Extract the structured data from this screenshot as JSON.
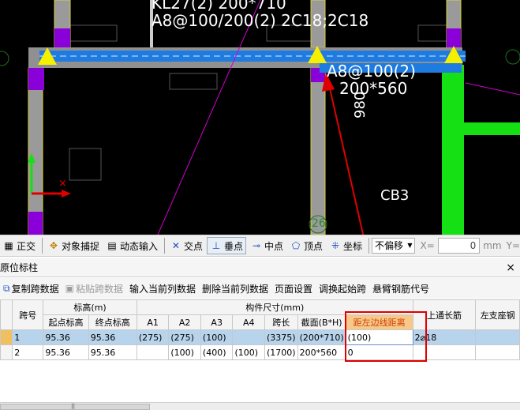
{
  "cad": {
    "beam_label_1": "KL27(2) 200*710",
    "beam_label_2": "A8@100/200(2) 2C18;2C18",
    "beam_label_3": "A8@100(2)",
    "beam_label_4": "200*560",
    "beam_label_5": "980",
    "beam_label_6": "CB3",
    "beam_label_7": "26"
  },
  "snapbar": {
    "items": [
      "正交",
      "对象捕捉",
      "动态输入",
      "交点",
      "垂点",
      "中点",
      "顶点",
      "坐标"
    ],
    "offset_select": "不偏移",
    "x_label": "X=",
    "x_value": "0",
    "unit": "mm",
    "y_label": "Y="
  },
  "panel": {
    "title": "原位标柱",
    "close": "×",
    "toolbar": [
      "复制跨数据",
      "粘贴跨数据",
      "输入当前列数据",
      "删除当前列数据",
      "页面设置",
      "调换起始跨",
      "悬臂钢筋代号"
    ]
  },
  "table": {
    "group_headers": {
      "span": "跨号",
      "elevation": "标高(m)",
      "size": "构件尺寸(mm)",
      "top_long": "上通长筋",
      "left_support": "左支座钢"
    },
    "sub_headers": [
      "起点标高",
      "终点标高",
      "A1",
      "A2",
      "A3",
      "A4",
      "跨长",
      "截面(B*H)",
      "距左边线距离"
    ],
    "rows": [
      {
        "span": "1",
        "start": "95.36",
        "end": "95.36",
        "a1": "(275)",
        "a2": "(275)",
        "a3": "(100)",
        "a4": "",
        "len": "(3375)",
        "sec": "(200*710)",
        "dist": "(100)",
        "top": "2⌀18",
        "left": ""
      },
      {
        "span": "2",
        "start": "95.36",
        "end": "95.36",
        "a1": "",
        "a2": "(100)",
        "a3": "(400)",
        "a4": "(100)",
        "len": "(1700)",
        "sec": "200*560",
        "dist": "0",
        "top": "",
        "left": ""
      }
    ]
  },
  "scroll": {
    "grip": "|||"
  },
  "colors": {
    "highlight_header": "#f6c98a",
    "selected_row": "#b8d4ec",
    "annotation": "#e00000",
    "beam_blue": "#1e7be0",
    "green": "#14e014"
  }
}
